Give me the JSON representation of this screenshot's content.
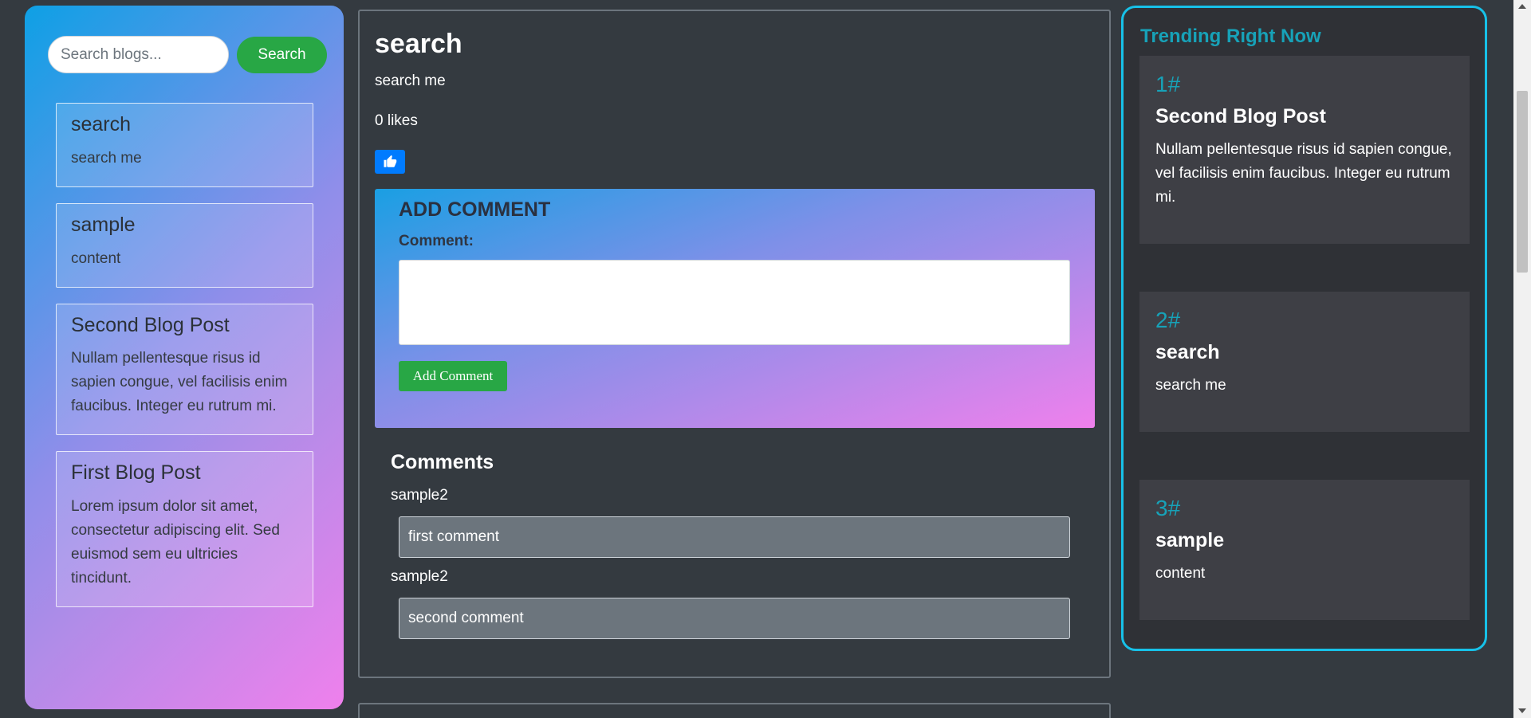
{
  "search": {
    "placeholder": "Search blogs...",
    "value": "",
    "button_label": "Search"
  },
  "sidebar": {
    "posts": [
      {
        "title": "search",
        "excerpt": "search me"
      },
      {
        "title": "sample",
        "excerpt": "content"
      },
      {
        "title": "Second Blog Post",
        "excerpt": "Nullam pellentesque risus id sapien congue, vel facilisis enim faucibus. Integer eu rutrum mi."
      },
      {
        "title": "First Blog Post",
        "excerpt": "Lorem ipsum dolor sit amet, consectetur adipiscing elit. Sed euismod sem eu ultricies tincidunt."
      }
    ]
  },
  "post": {
    "title": "search",
    "body": "search me",
    "likes_text": "0 likes",
    "like_icon": "thumbs-up-icon"
  },
  "add_comment": {
    "heading": "ADD COMMENT",
    "label": "Comment:",
    "value": "",
    "submit_label": "Add Comment"
  },
  "comments": {
    "heading": "Comments",
    "items": [
      {
        "author": "sample2",
        "text": "first comment"
      },
      {
        "author": "sample2",
        "text": "second comment"
      }
    ]
  },
  "trending": {
    "heading": "Trending Right Now",
    "items": [
      {
        "rank": "1#",
        "title": "Second Blog Post",
        "excerpt": "Nullam pellentesque risus id sapien congue, vel facilisis enim faucibus. Integer eu rutrum mi."
      },
      {
        "rank": "2#",
        "title": "search",
        "excerpt": "search me"
      },
      {
        "rank": "3#",
        "title": "sample",
        "excerpt": "content"
      }
    ]
  },
  "colors": {
    "background": "#343a40",
    "success": "#28a745",
    "primary": "#007bff",
    "info": "#17a2b8",
    "trending_border": "#17c1e8"
  }
}
